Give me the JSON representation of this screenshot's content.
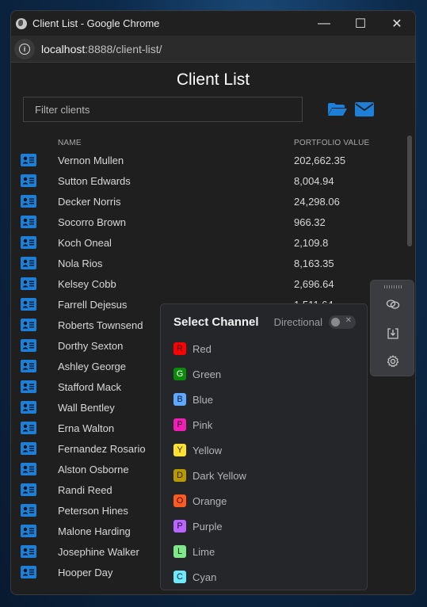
{
  "window": {
    "title": "Client List - Google Chrome",
    "url_host": "localhost",
    "url_rest": ":8888/client-list/",
    "minimize_label": "—",
    "maximize_label": "☐",
    "close_label": "✕"
  },
  "page": {
    "title": "Client List",
    "filter_placeholder": "Filter clients",
    "filter_value": ""
  },
  "table": {
    "columns": [
      "NAME",
      "PORTFOLIO VALUE"
    ],
    "rows": [
      {
        "name": "Vernon Mullen",
        "value": "202,662.35"
      },
      {
        "name": "Sutton Edwards",
        "value": "8,004.94"
      },
      {
        "name": "Decker Norris",
        "value": "24,298.06"
      },
      {
        "name": "Socorro Brown",
        "value": "966.32"
      },
      {
        "name": "Koch Oneal",
        "value": "2,109.8"
      },
      {
        "name": "Nola Rios",
        "value": "8,163.35"
      },
      {
        "name": "Kelsey Cobb",
        "value": "2,696.64"
      },
      {
        "name": "Farrell Dejesus",
        "value": "1,511.64"
      },
      {
        "name": "Roberts Townsend",
        "value": ""
      },
      {
        "name": "Dorthy Sexton",
        "value": ""
      },
      {
        "name": "Ashley George",
        "value": ""
      },
      {
        "name": "Stafford Mack",
        "value": ""
      },
      {
        "name": "Wall Bentley",
        "value": ""
      },
      {
        "name": "Erna Walton",
        "value": ""
      },
      {
        "name": "Fernandez Rosario",
        "value": ""
      },
      {
        "name": "Alston Osborne",
        "value": ""
      },
      {
        "name": "Randi Reed",
        "value": ""
      },
      {
        "name": "Peterson Hines",
        "value": ""
      },
      {
        "name": "Malone Harding",
        "value": ""
      },
      {
        "name": "Josephine Walker",
        "value": ""
      },
      {
        "name": "Hooper Day",
        "value": ""
      }
    ]
  },
  "popup": {
    "title": "Select Channel",
    "directional_label": "Directional",
    "directional_on": false,
    "channels": [
      {
        "letter": "R",
        "label": "Red",
        "color": "#ff0000",
        "text": "#3a0000"
      },
      {
        "letter": "G",
        "label": "Green",
        "color": "#0a8a0a",
        "text": "#ffffff"
      },
      {
        "letter": "B",
        "label": "Blue",
        "color": "#5ea8ff",
        "text": "#0a1a33"
      },
      {
        "letter": "P",
        "label": "Pink",
        "color": "#f01fb4",
        "text": "#3a0028"
      },
      {
        "letter": "Y",
        "label": "Yellow",
        "color": "#ffe033",
        "text": "#3a3000"
      },
      {
        "letter": "D",
        "label": "Dark Yellow",
        "color": "#b89a00",
        "text": "#2a2200"
      },
      {
        "letter": "O",
        "label": "Orange",
        "color": "#ff5a1f",
        "text": "#3a0e00"
      },
      {
        "letter": "P",
        "label": "Purple",
        "color": "#b866ff",
        "text": "#230a3a"
      },
      {
        "letter": "L",
        "label": "Lime",
        "color": "#7fe88a",
        "text": "#0a2a0e"
      },
      {
        "letter": "C",
        "label": "Cyan",
        "color": "#6fe8ff",
        "text": "#062a33"
      }
    ]
  },
  "colors": {
    "accent": "#1e7fd8"
  }
}
